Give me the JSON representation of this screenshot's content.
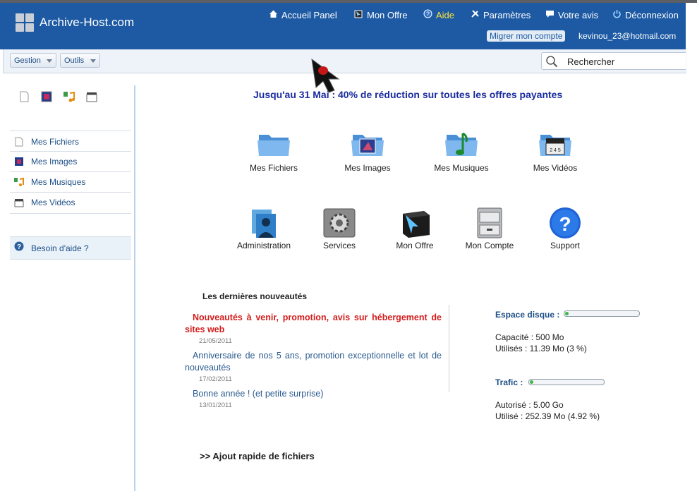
{
  "app": {
    "logo_text": "Archive-Host.com"
  },
  "nav": [
    {
      "label": "Accueil Panel",
      "icon": "home-icon"
    },
    {
      "label": "Mon Offre",
      "icon": "offer-icon"
    },
    {
      "label": "Aide",
      "icon": "help-icon"
    },
    {
      "label": "Paramètres",
      "icon": "tools-icon"
    },
    {
      "label": "Votre avis",
      "icon": "comment-icon"
    },
    {
      "label": "Déconnexion",
      "icon": "power-icon"
    }
  ],
  "account": {
    "migrate_label": "Migrer mon compte",
    "email": "kevinou_23@hotmail.com"
  },
  "toolbar": {
    "gestion": "Gestion",
    "outils": "Outils",
    "search_placeholder": "Rechercher"
  },
  "sidebar": {
    "items": [
      {
        "label": "Mes Fichiers",
        "icon": "file-icon"
      },
      {
        "label": "Mes Images",
        "icon": "image-icon"
      },
      {
        "label": "Mes Musiques",
        "icon": "music-icon"
      },
      {
        "label": "Mes Vidéos",
        "icon": "video-icon"
      }
    ],
    "help": "Besoin d'aide ?"
  },
  "promo": "Jusqu'au 31 Mai : 40% de réduction sur toutes les offres payantes",
  "tiles_row1": [
    "Mes Fichiers",
    "Mes Images",
    "Mes Musiques",
    "Mes Vidéos"
  ],
  "tiles_row2": [
    "Administration",
    "Services",
    "Mon Offre",
    "Mon Compte",
    "Support"
  ],
  "news": {
    "title": "Les dernières nouveautés",
    "items": [
      {
        "text": "Nouveautés à venir, promotion, avis sur hébergement de sites web",
        "date": "21/05/2011"
      },
      {
        "text": "Anniversaire de nos 5 ans, promotion exceptionnelle et lot de nouveautés",
        "date": "17/02/2011"
      },
      {
        "text": "Bonne année ! (et petite surprise)",
        "date": "13/01/2011"
      }
    ]
  },
  "disk": {
    "label": "Espace disque :",
    "capacity": "Capacité : 500 Mo",
    "used": "Utilisés : 11.39 Mo (3 %)",
    "fraction": 0.03
  },
  "traffic": {
    "label": "Trafic :",
    "allowed": "Autorisé : 5.00 Go",
    "used": "Utilisé : 252.39 Mo (4.92 %)",
    "fraction": 0.0492
  },
  "quick_add": ">> Ajout rapide de fichiers",
  "colors": {
    "header": "#1d5aa3",
    "link": "#1d4f86",
    "promo": "#1a2c9e",
    "hot_news": "#d31c1c",
    "progress": "#3fb54a"
  }
}
